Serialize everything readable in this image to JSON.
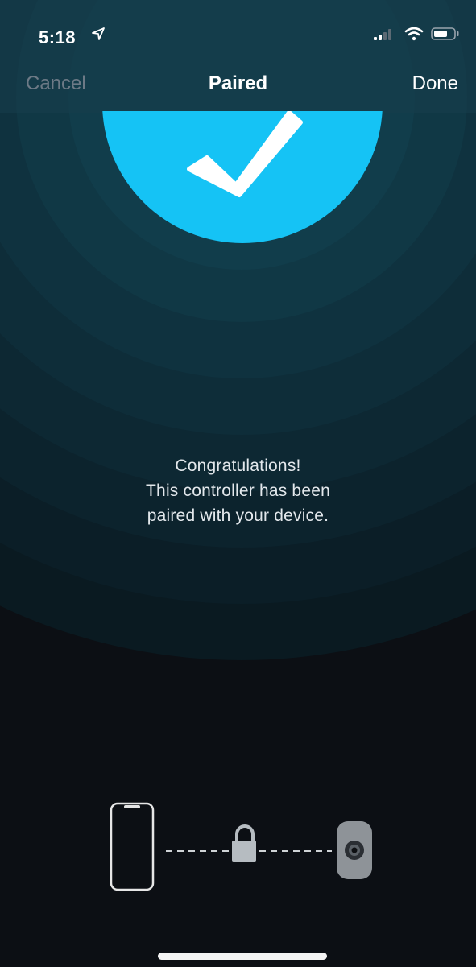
{
  "status_bar": {
    "time": "5:18",
    "icons": [
      "location-arrow-icon",
      "cellular-signal-icon",
      "wifi-icon",
      "battery-icon"
    ]
  },
  "nav": {
    "cancel_label": "Cancel",
    "title": "Paired",
    "done_label": "Done"
  },
  "success": {
    "icon": "checkmark-icon",
    "color": "#15c3f5"
  },
  "message": {
    "line1": "Congratulations!",
    "line2": "This controller has been",
    "line3": "paired with your device."
  },
  "pairing_graphic": {
    "icons": [
      "phone-icon",
      "lock-icon",
      "controller-icon"
    ]
  },
  "colors": {
    "accent": "#15c3f5",
    "background": "#0c0f14",
    "ring_dark": "#0f2a35",
    "disabled_text": "#6d7a86"
  }
}
